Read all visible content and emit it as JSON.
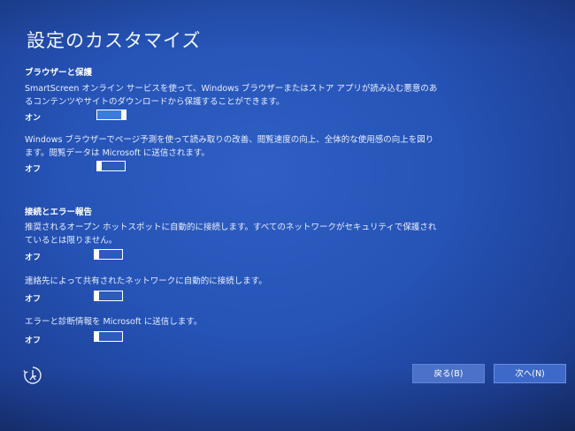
{
  "title": "設定のカスタマイズ",
  "sections": [
    {
      "heading": "ブラウザーと保護",
      "settings": [
        {
          "description": "SmartScreen オンライン サービスを使って、Windows ブラウザーまたはストア アプリが読み込む悪意のあるコンテンツやサイトのダウンロードから保護することができます。",
          "state": "オン",
          "value": true
        },
        {
          "description": "Windows ブラウザーでページ予測を使って読み取りの改善、閲覧速度の向上、全体的な使用感の向上を図ります。閲覧データは Microsoft に送信されます。",
          "state": "オフ",
          "value": false
        }
      ]
    },
    {
      "heading": "接続とエラー報告",
      "settings": [
        {
          "description": "推奨されるオープン ホットスポットに自動的に接続します。すべてのネットワークがセキュリティで保護されているとは限りません。",
          "state": "オフ",
          "value": false
        },
        {
          "description": "連絡先によって共有されたネットワークに自動的に接続します。",
          "state": "オフ",
          "value": false
        },
        {
          "description": "エラーと診断情報を Microsoft に送信します。",
          "state": "オフ",
          "value": false
        }
      ]
    }
  ],
  "buttons": {
    "back": "戻る(B)",
    "next": "次へ(N)"
  },
  "icons": {
    "ease_of_access": "ease-of-access-icon"
  },
  "colors": {
    "background": "#2553b6",
    "button": "#4b72c8"
  }
}
